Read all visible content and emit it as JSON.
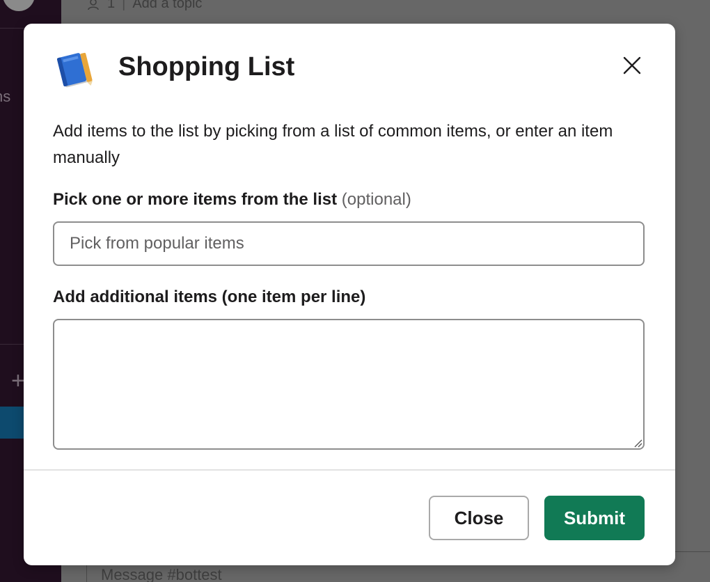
{
  "background": {
    "channel_member_count": "1",
    "add_topic": "Add a topic",
    "sidebar_partial_text": "ns",
    "composer_placeholder": "Message #bottest",
    "plus_symbol": "+"
  },
  "modal": {
    "title": "Shopping List",
    "app_icon": "notebook-icon",
    "close_icon": "close-icon",
    "description": "Add items to the list by picking from a list of common items, or enter an item manually",
    "pick_label": "Pick one or more items from the list",
    "pick_optional": "(optional)",
    "pick_placeholder": "Pick from popular items",
    "additional_label": "Add additional items (one item per line)",
    "additional_value": "",
    "close_button": "Close",
    "submit_button": "Submit"
  },
  "colors": {
    "submit_bg": "#117a55",
    "overlay": "#5c5c5c",
    "sidebar": "#1f0e1e"
  }
}
